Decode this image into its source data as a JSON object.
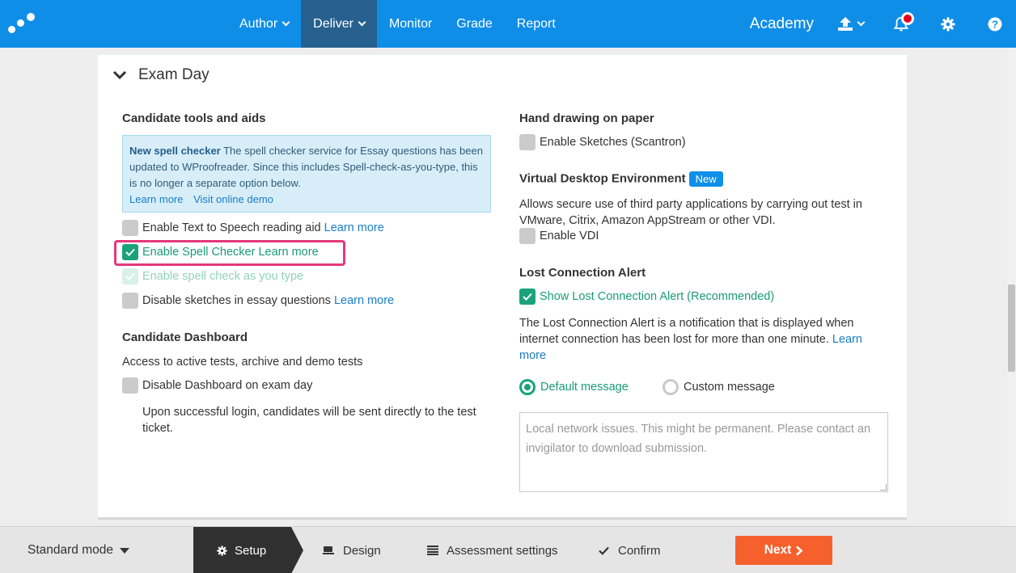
{
  "nav": {
    "items": [
      {
        "label": "Author",
        "dropdown": true,
        "active": false
      },
      {
        "label": "Deliver",
        "dropdown": true,
        "active": true
      },
      {
        "label": "Monitor",
        "dropdown": false,
        "active": false
      },
      {
        "label": "Grade",
        "dropdown": false,
        "active": false
      },
      {
        "label": "Report",
        "dropdown": false,
        "active": false
      }
    ],
    "academy": "Academy",
    "icons": [
      "upload-icon",
      "bell-icon",
      "gear-icon",
      "help-icon"
    ]
  },
  "colors": {
    "topbar": "#0f8ee8",
    "active_nav": "#26608f",
    "accent_green": "#1aa37a",
    "link": "#1a7cc6",
    "next_button": "#f5602d",
    "highlight": "#e5387a"
  },
  "card": {
    "title": "Exam Day",
    "left": {
      "tools_heading": "Candidate tools and aids",
      "info": {
        "bold": "New spell checker",
        "text1": " The spell checker service for Essay questions has been updated to ",
        "product": "WProofreader",
        "text2": ". Since this includes Spell-check-as-you-type, this is no longer a separate option below.",
        "link1": "Learn more",
        "link2": "Visit online demo"
      },
      "tts_label": "Enable Text to Speech reading aid",
      "tts_link": "Learn more",
      "spell_label": "Enable Spell Checker",
      "spell_link": "Learn more",
      "spell_type_label": "Enable spell check as you type",
      "sketch_label": "Disable sketches in essay questions",
      "sketch_link": "Learn more",
      "dashboard_heading": "Candidate Dashboard",
      "dashboard_desc": "Access to active tests, archive and demo tests",
      "dashboard_label": "Disable Dashboard on exam day",
      "dashboard_note": "Upon successful login, candidates will be sent directly to the test ticket."
    },
    "right": {
      "hand_heading": "Hand drawing on paper",
      "sketches_label": "Enable Sketches (Scantron)",
      "vde_heading": "Virtual Desktop Environment",
      "vde_badge": "New",
      "vde_desc": "Allows secure use of third party applications by carrying out test in VMware, Citrix, Amazon AppStream or other VDI.",
      "vdi_label": "Enable VDI",
      "lca_heading": "Lost Connection Alert",
      "lca_label": "Show Lost Connection Alert (Recommended)",
      "lca_desc": "The Lost Connection Alert is a notification that is displayed when internet connection has been lost for more than one minute. ",
      "lca_link": "Learn more",
      "radio_default": "Default message",
      "radio_custom": "Custom message",
      "message_text": "Local network issues. This might be permanent. Please contact an invigilator to download submission."
    }
  },
  "bottom": {
    "mode": "Standard mode",
    "steps": {
      "setup": "Setup",
      "design": "Design",
      "assessment": "Assessment settings",
      "confirm": "Confirm"
    },
    "next": "Next"
  }
}
